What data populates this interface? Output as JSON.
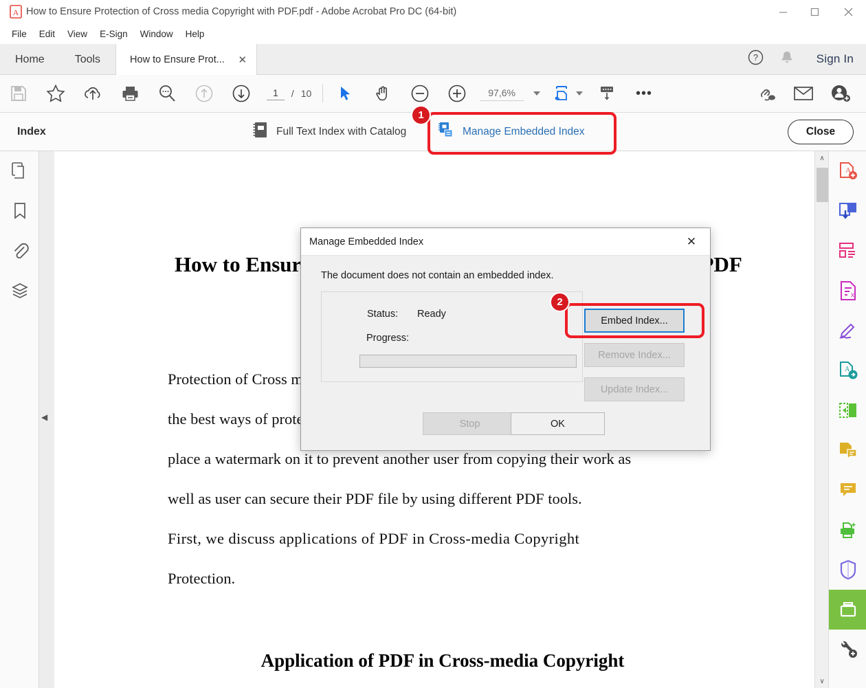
{
  "window": {
    "title": "How to Ensure Protection of Cross media Copyright with PDF.pdf - Adobe Acrobat Pro DC (64-bit)",
    "app_icon": "acrobat-pdf-icon",
    "minimize_label": "—",
    "maximize_label": "□",
    "close_label": "✕"
  },
  "menubar": {
    "items": [
      {
        "label": "File"
      },
      {
        "label": "Edit"
      },
      {
        "label": "View"
      },
      {
        "label": "E-Sign"
      },
      {
        "label": "Window"
      },
      {
        "label": "Help"
      }
    ]
  },
  "tabstrip": {
    "home_label": "Home",
    "tools_label": "Tools",
    "document_tab": "How to Ensure Prot...",
    "document_tab_close": "✕",
    "help_icon": "question-circle-icon",
    "bell_icon": "bell-icon",
    "sign_in_label": "Sign In"
  },
  "toolbar": {
    "icons_left": [
      {
        "name": "save-icon"
      },
      {
        "name": "star-icon"
      },
      {
        "name": "upload-cloud-icon"
      },
      {
        "name": "print-icon"
      },
      {
        "name": "search-icon"
      },
      {
        "name": "previous-page-icon"
      },
      {
        "name": "next-page-icon"
      }
    ],
    "page_current": "1",
    "page_separator": "/",
    "page_total": "10",
    "icons_mid": [
      {
        "name": "select-cursor-icon"
      },
      {
        "name": "hand-tool-icon"
      },
      {
        "name": "zoom-out-icon"
      },
      {
        "name": "zoom-in-icon"
      }
    ],
    "zoom_value": "97,6%",
    "zoom_caret": "▾",
    "fit_page_icon": "fit-page-icon",
    "scroll_mode_icon": "scroll-mode-icon",
    "more_tools_label": "•••",
    "icons_right": [
      {
        "name": "share-link-icon"
      },
      {
        "name": "email-icon"
      },
      {
        "name": "add-person-icon"
      }
    ]
  },
  "index_bar": {
    "title": "Index",
    "full_text_label": "Full Text Index with Catalog",
    "full_text_icon": "catalog-book-icon",
    "manage_label": "Manage Embedded Index",
    "manage_icon": "embedded-index-icon",
    "close_label": "Close",
    "accent_color": "#7ac143",
    "link_color": "#2a6fb5"
  },
  "left_rail": {
    "items": [
      {
        "name": "page-thumbnails-icon"
      },
      {
        "name": "bookmarks-icon"
      },
      {
        "name": "attachments-icon"
      },
      {
        "name": "layers-icon"
      }
    ],
    "collapse_arrow": "◀"
  },
  "right_rail": {
    "items": [
      {
        "name": "create-pdf-icon",
        "color": "#e8564a"
      },
      {
        "name": "combine-files-icon",
        "color": "#4a63d8"
      },
      {
        "name": "edit-pdf-icon",
        "color": "#e6307c"
      },
      {
        "name": "export-pdf-icon",
        "color": "#c92bbd"
      },
      {
        "name": "fill-and-sign-icon",
        "color": "#8a4fd6"
      },
      {
        "name": "send-for-comments-icon",
        "color": "#1b9b9b"
      },
      {
        "name": "organize-pages-icon",
        "color": "#5bc236"
      },
      {
        "name": "scan-and-ocr-icon",
        "color": "#ddb028"
      },
      {
        "name": "comment-icon",
        "color": "#e3b02a"
      },
      {
        "name": "enhance-scans-icon",
        "color": "#4fbe3c"
      },
      {
        "name": "protect-icon",
        "color": "#7a6ae0"
      },
      {
        "name": "index-active-icon",
        "color": "#ffffff"
      },
      {
        "name": "more-tools-wrench-icon",
        "color": "#4a4a4a"
      }
    ],
    "active_index": 11,
    "active_bg": "#7ac143"
  },
  "document": {
    "heading": "How to Ensure Protection of Cross media Copyright with PDF",
    "paragraphs": [
      "Protection of Cross media Copyright is important for every user and one of",
      "the best ways of protecting their work is by converting it into PDF and",
      "place a watermark on it to prevent another user from copying their work as",
      "well as user can secure their PDF file by using different PDF tools.",
      "First,  we  discuss  applications  of  PDF  in  Cross-media  Copyright",
      "Protection."
    ],
    "subheading": "Application of PDF in Cross-media Copyright"
  },
  "scrollbar": {
    "up_arrow": "∧",
    "down_arrow": "∨"
  },
  "dialog": {
    "title": "Manage Embedded Index",
    "close_label": "✕",
    "message": "The document does not contain an embedded index.",
    "status_label": "Status:",
    "status_value": "Ready",
    "progress_label": "Progress:",
    "progress_value": 0,
    "buttons": {
      "embed": "Embed Index...",
      "remove": "Remove Index...",
      "update": "Update Index...",
      "stop": "Stop",
      "ok": "OK"
    }
  },
  "annotations": {
    "badge_1": "1",
    "badge_2": "2",
    "highlight_color": "#ee1c25",
    "badge_color": "#d71920"
  }
}
